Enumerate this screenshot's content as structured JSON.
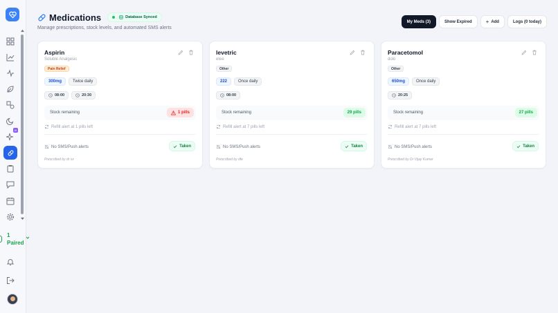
{
  "header": {
    "title": "Medications",
    "sync_status": "Database Synced",
    "subtitle": "Manage prescriptions, stock levels, and automated SMS alerts"
  },
  "toolbar": {
    "my_meds": "My Meds (3)",
    "show_expired": "Show Expired",
    "add": "Add",
    "logs": "Logs (0 today)"
  },
  "sidebar": {
    "paired_count": "1",
    "paired_label": "Paired",
    "ai_badge": "AI"
  },
  "colors": {
    "accent": "#2563eb",
    "success": "#16a34a",
    "danger": "#dc2626"
  },
  "medications": [
    {
      "name": "Aspirin",
      "generic": "Soluble Analgesic",
      "tag": "Pain Relief",
      "dose": "300mg",
      "frequency": "Twice daily",
      "times": [
        "08:00",
        "20:30"
      ],
      "stock_label": "Stock remaining",
      "stock": "1 pills",
      "stock_status": "low",
      "refill": "Refill alert at 1 pills left",
      "alerts": "No SMS/Push alerts",
      "taken_label": "Taken",
      "prescribed": "Prescribed by dr xx"
    },
    {
      "name": "levetric",
      "generic": "etee",
      "tag": "Other",
      "dose": "222",
      "frequency": "Once daily",
      "times": [
        "08:00"
      ],
      "stock_label": "Stock remaining",
      "stock": "29 pills",
      "stock_status": "ok",
      "refill": "Refill alert at 7 pills left",
      "alerts": "No SMS/Push alerts",
      "taken_label": "Taken",
      "prescribed": "Prescribed by dfe"
    },
    {
      "name": "Paracetomol",
      "generic": "dolo",
      "tag": "Other",
      "dose": "650mg",
      "frequency": "Once daily",
      "times": [
        "20:25"
      ],
      "stock_label": "Stock remaining",
      "stock": "27 pills",
      "stock_status": "ok",
      "refill": "Refill alert at 7 pills left",
      "alerts": "No SMS/Push alerts",
      "taken_label": "Taken",
      "prescribed": "Prescribed by Dr Vijay Kumar"
    }
  ]
}
